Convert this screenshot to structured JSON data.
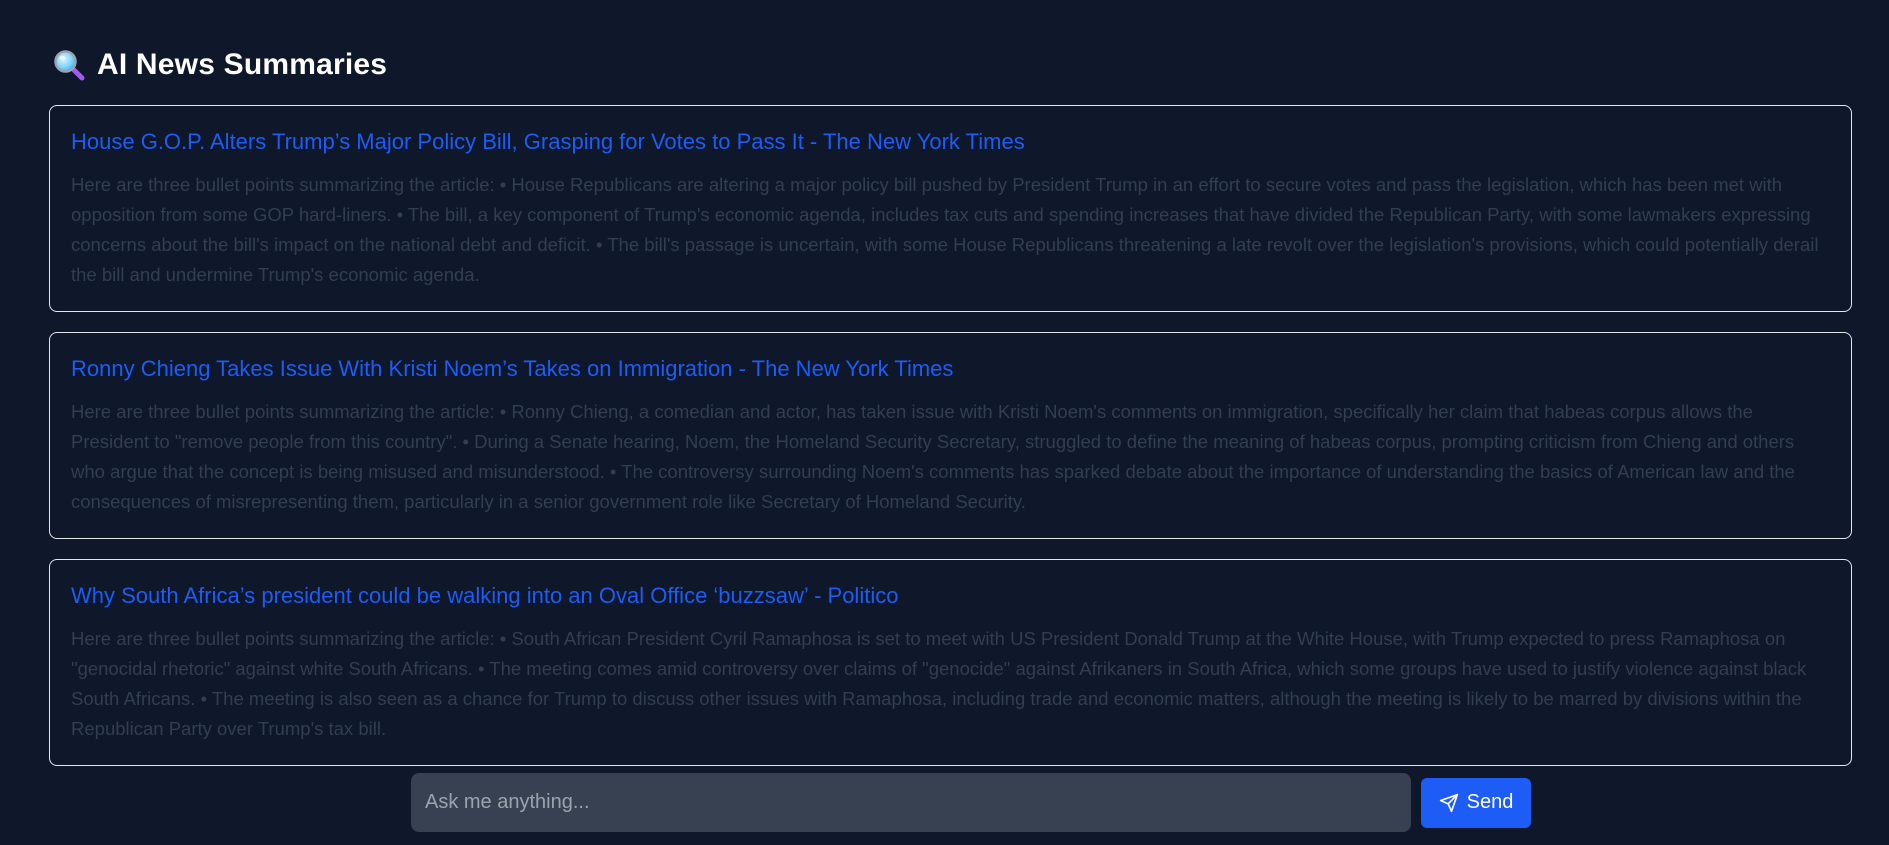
{
  "header": {
    "icon": "magnifying-glass-icon",
    "title": "AI News Summaries"
  },
  "articles": [
    {
      "title": "House G.O.P. Alters Trump’s Major Policy Bill, Grasping for Votes to Pass It - The New York Times",
      "summary": "Here are three bullet points summarizing the article: • House Republicans are altering a major policy bill pushed by President Trump in an effort to secure votes and pass the legislation, which has been met with opposition from some GOP hard-liners. • The bill, a key component of Trump's economic agenda, includes tax cuts and spending increases that have divided the Republican Party, with some lawmakers expressing concerns about the bill's impact on the national debt and deficit. • The bill's passage is uncertain, with some House Republicans threatening a late revolt over the legislation's provisions, which could potentially derail the bill and undermine Trump's economic agenda."
    },
    {
      "title": "Ronny Chieng Takes Issue With Kristi Noem’s Takes on Immigration - The New York Times",
      "summary": "Here are three bullet points summarizing the article: • Ronny Chieng, a comedian and actor, has taken issue with Kristi Noem's comments on immigration, specifically her claim that habeas corpus allows the President to \"remove people from this country\". • During a Senate hearing, Noem, the Homeland Security Secretary, struggled to define the meaning of habeas corpus, prompting criticism from Chieng and others who argue that the concept is being misused and misunderstood. • The controversy surrounding Noem's comments has sparked debate about the importance of understanding the basics of American law and the consequences of misrepresenting them, particularly in a senior government role like Secretary of Homeland Security."
    },
    {
      "title": "Why South Africa’s president could be walking into an Oval Office ‘buzzsaw’ - Politico",
      "summary": "Here are three bullet points summarizing the article: • South African President Cyril Ramaphosa is set to meet with US President Donald Trump at the White House, with Trump expected to press Ramaphosa on \"genocidal rhetoric\" against white South Africans. • The meeting comes amid controversy over claims of \"genocide\" against Afrikaners in South Africa, which some groups have used to justify violence against black South Africans. • The meeting is also seen as a chance for Trump to discuss other issues with Ramaphosa, including trade and economic matters, although the meeting is likely to be marred by divisions within the Republican Party over Trump's tax bill."
    }
  ],
  "composer": {
    "placeholder": "Ask me anything...",
    "send_label": "Send",
    "send_icon": "paper-plane-icon"
  },
  "colors": {
    "background": "#0f172a",
    "link": "#1d5cf5",
    "summary_text": "#323e52",
    "input_bg": "#374151",
    "card_border": "#e5e7eb"
  }
}
